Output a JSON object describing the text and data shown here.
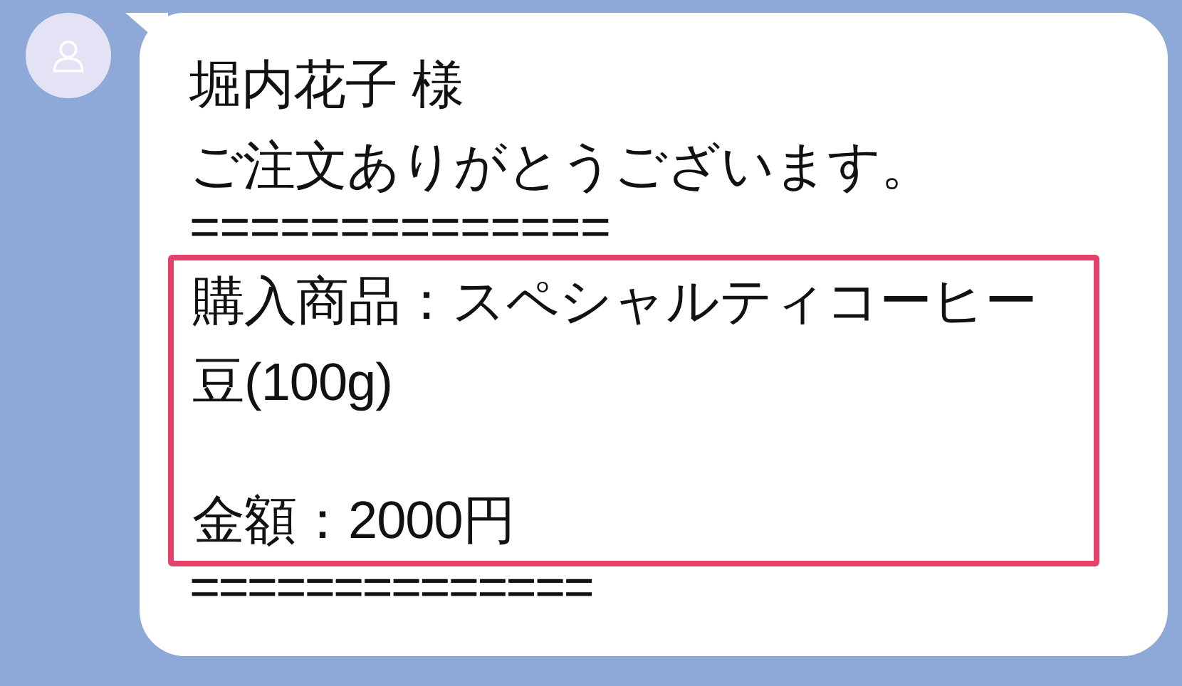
{
  "message": {
    "header_lines": [
      "堀内花子 様",
      "ご注文ありがとうございます。",
      "=============="
    ],
    "highlighted_lines": [
      "購入商品：スペシャルティコーヒー",
      "豆(100g)"
    ],
    "highlighted_total": "金額：2000円",
    "footer_lines": [
      "=============="
    ]
  }
}
